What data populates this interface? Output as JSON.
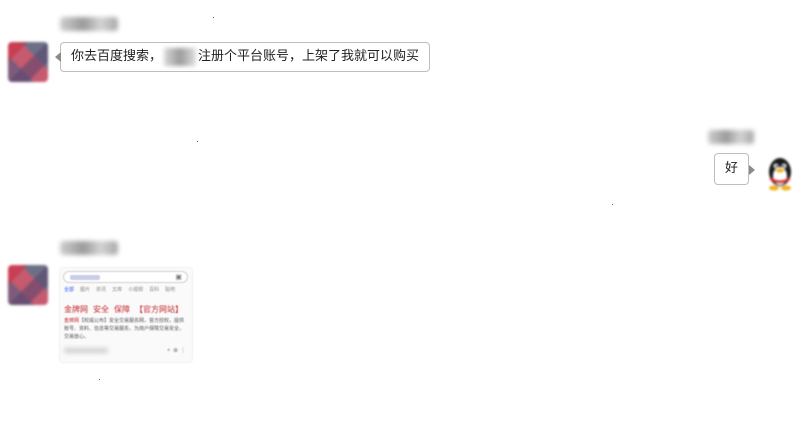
{
  "chat": {
    "messages": [
      {
        "side": "left",
        "kind": "text",
        "text_before": "你去百度搜索，",
        "text_after": "注册个平台账号，上架了我就可以购买"
      },
      {
        "side": "right",
        "kind": "text",
        "text": "好"
      },
      {
        "side": "left",
        "kind": "image",
        "screenshot": {
          "tabs": [
            "全部",
            "图片",
            "资讯",
            "文库",
            "小视频",
            "百科",
            "贴吧"
          ],
          "result_title": [
            "金牌网",
            "安全",
            "保障",
            "【官方网站】"
          ],
          "desc_highlight": "金牌网",
          "desc_text": "【权威公布】安全交易服务网，官方授权，提供账号、资料、信息等交易服务，为用户保障交易安全，交易放心。"
        }
      }
    ]
  },
  "colors": {
    "background": "#ffffff",
    "bubble_border": "#bdbdbd",
    "link_red": "#c4282e",
    "baidu_blue": "#315efb"
  }
}
